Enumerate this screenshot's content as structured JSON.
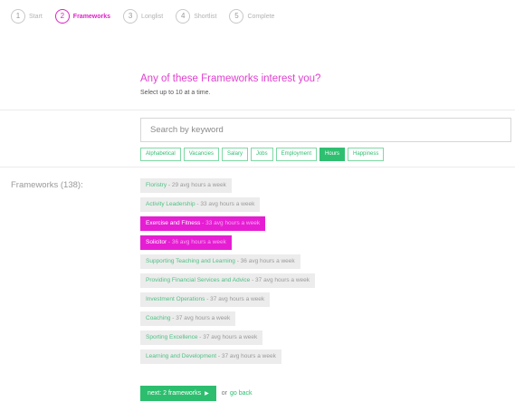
{
  "steps": [
    {
      "num": "1",
      "label": "Start"
    },
    {
      "num": "2",
      "label": "Frameworks"
    },
    {
      "num": "3",
      "label": "Longlist"
    },
    {
      "num": "4",
      "label": "Shortlist"
    },
    {
      "num": "5",
      "label": "Complete"
    }
  ],
  "active_step": 2,
  "main": {
    "heading": "Any of these Frameworks interest you?",
    "subheading": "Select up to 10 at a time."
  },
  "search": {
    "placeholder": "Search by keyword",
    "value": ""
  },
  "filters": [
    "Alphabetical",
    "Vacancies",
    "Salary",
    "Jobs",
    "Employment",
    "Hours",
    "Happiness"
  ],
  "active_filter": "Hours",
  "frameworks_label": "Frameworks (138):",
  "frameworks": [
    {
      "name": "Floristry",
      "meta": " - 29 avg hours a week",
      "selected": false
    },
    {
      "name": "Activity Leadership",
      "meta": " - 33 avg hours a week",
      "selected": false
    },
    {
      "name": "Exercise and Fitness",
      "meta": " - 33 avg hours a week",
      "selected": true
    },
    {
      "name": "Solicitor",
      "meta": " - 36 avg hours a week",
      "selected": true
    },
    {
      "name": "Supporting Teaching and Learning",
      "meta": " - 36 avg hours a week",
      "selected": false
    },
    {
      "name": "Providing Financial Services and Advice",
      "meta": " - 37 avg hours a week",
      "selected": false
    },
    {
      "name": "Investment Operations",
      "meta": " - 37 avg hours a week",
      "selected": false
    },
    {
      "name": "Coaching",
      "meta": " - 37 avg hours a week",
      "selected": false
    },
    {
      "name": "Sporting Excellence",
      "meta": " - 37 avg hours a week",
      "selected": false
    },
    {
      "name": "Learning and Development",
      "meta": " - 37 avg hours a week",
      "selected": false
    }
  ],
  "footer": {
    "next_label": "next: 2 frameworks",
    "next_arrow": "▶",
    "or_text": "or",
    "back_label": "go back"
  },
  "colors": {
    "accent_magenta": "#e51ed3",
    "accent_green": "#2cbe6e"
  }
}
